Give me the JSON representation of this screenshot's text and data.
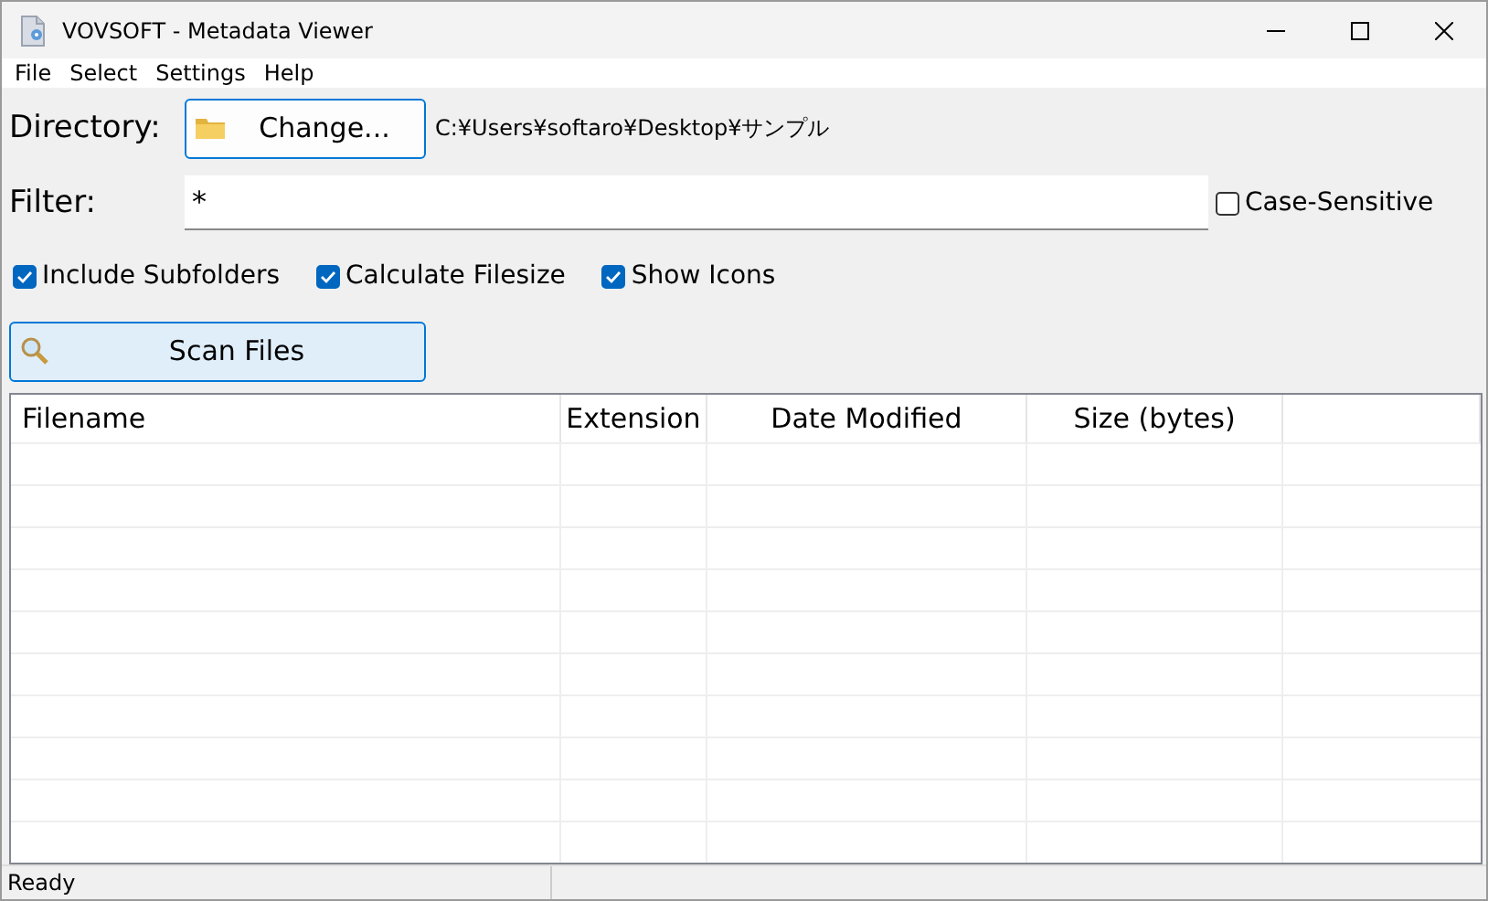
{
  "window": {
    "title": "VOVSOFT - Metadata Viewer"
  },
  "menu": [
    "File",
    "Select",
    "Settings",
    "Help"
  ],
  "directory": {
    "label": "Directory:",
    "button": "Change...",
    "path": "C:¥Users¥softaro¥Desktop¥サンプル"
  },
  "filter": {
    "label": "Filter:",
    "value": "*",
    "case_sensitive": {
      "label": "Case-Sensitive",
      "checked": false
    }
  },
  "options": [
    {
      "label": "Include Subfolders",
      "checked": true
    },
    {
      "label": "Calculate Filesize",
      "checked": true
    },
    {
      "label": "Show Icons",
      "checked": true
    }
  ],
  "scan_button": "Scan Files",
  "table": {
    "columns": [
      "Filename",
      "Extension",
      "Date Modified",
      "Size (bytes)"
    ]
  },
  "status_bar": "Ready"
}
